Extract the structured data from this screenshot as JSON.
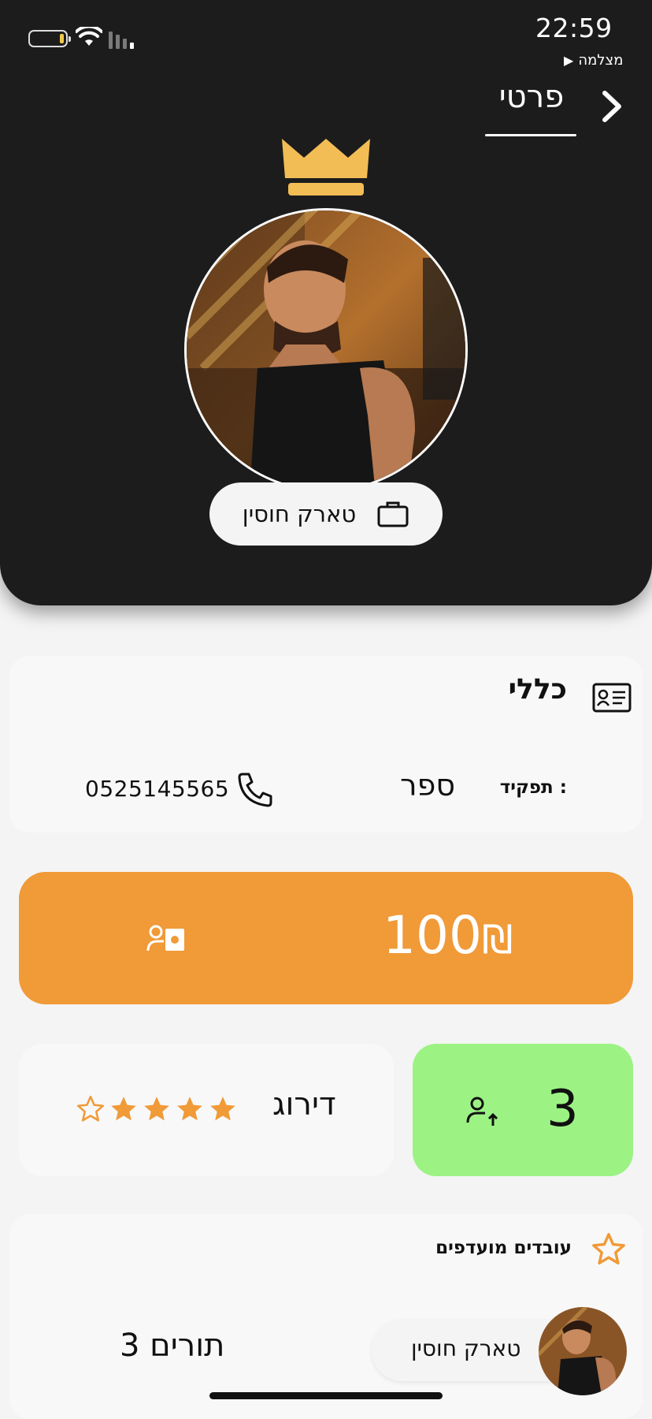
{
  "status_bar": {
    "time": "22:59",
    "back_app": "מצלמה"
  },
  "header": {
    "title": "פרטי",
    "employee_name": "טארק חוסין"
  },
  "general": {
    "title": "כללי",
    "role_label": "תפקיד :",
    "role_value": "ספר",
    "phone": "0525145565"
  },
  "balance": {
    "amount": "100",
    "currency": "₪"
  },
  "rating": {
    "label": "דירוג",
    "stars": 4,
    "max_stars": 5
  },
  "clients": {
    "count": "3"
  },
  "favorites": {
    "title": "עובדים מועדפים",
    "items": [
      {
        "name": "טארק חוסין",
        "count_label": "3 תורים"
      }
    ]
  },
  "colors": {
    "header_bg": "#1c1c1c",
    "accent_orange": "#f09a38",
    "crown_gold": "#f2bd55",
    "green": "#9cf384"
  },
  "icons": [
    "chevron-right-icon",
    "crown-icon",
    "briefcase-icon",
    "id-card-icon",
    "phone-icon",
    "money-icon",
    "star-icon",
    "user-up-icon",
    "wifi-icon",
    "battery-icon"
  ]
}
